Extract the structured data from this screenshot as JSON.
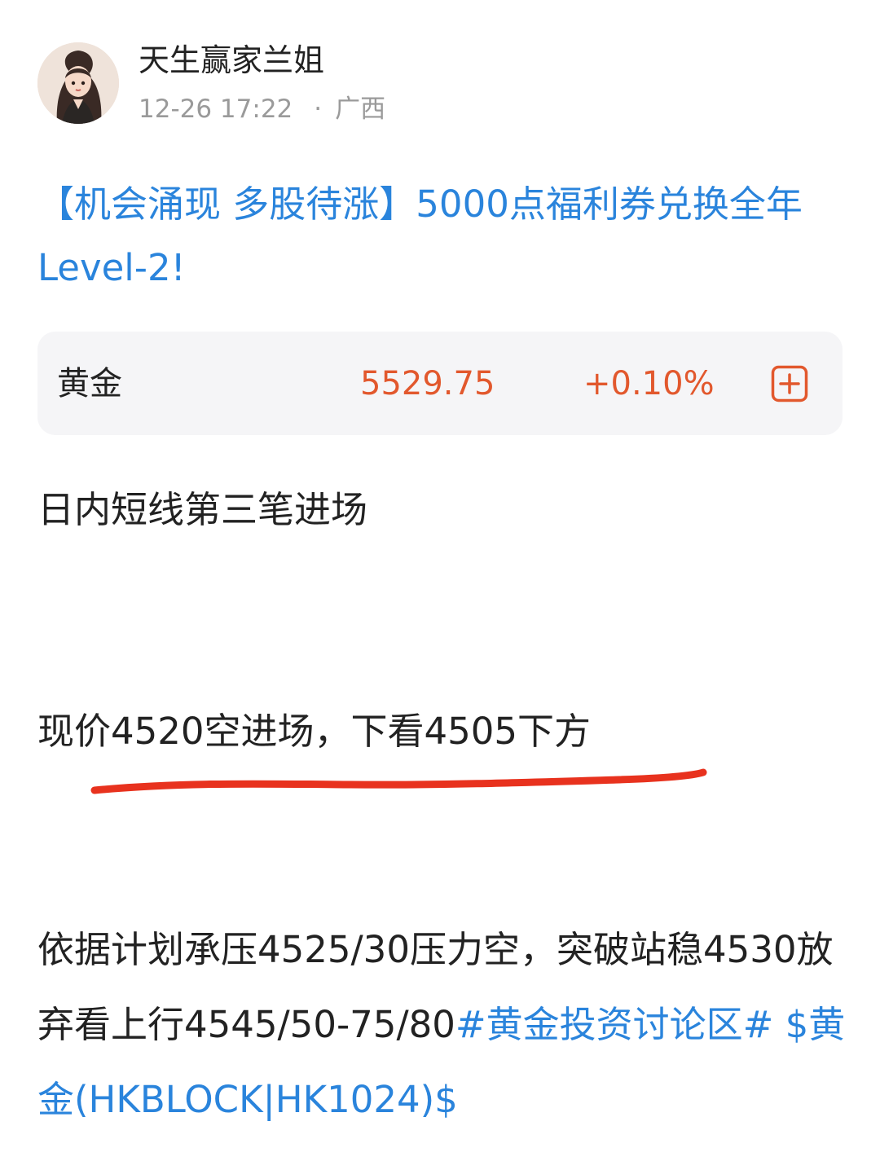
{
  "post": {
    "author": "天生赢家兰姐",
    "timestamp": "12-26 17:22",
    "separator": "·",
    "location": "广西",
    "title": "【机会涌现 多股待涨】5000点福利券兑换全年Level-2!"
  },
  "quote_card": {
    "name": "黄金",
    "price": "5529.75",
    "change": "+0.10%",
    "add_icon": "plus-square-icon"
  },
  "content": {
    "line1": "日内短线第三笔进场",
    "line2": "现价4520空进场，下看4505下方",
    "line3_text": "依据计划承压4525/30压力空，突破站稳4530放弃看上行4545/50-75/80",
    "hashtag": "#黄金投资讨论区#",
    "stock_tag": "$黄金(HKBLOCK|HK1024)$"
  },
  "colors": {
    "link": "#2a84dc",
    "price_up": "#e2582d",
    "underline": "#e8321e",
    "card_background": "#f5f5f7"
  }
}
